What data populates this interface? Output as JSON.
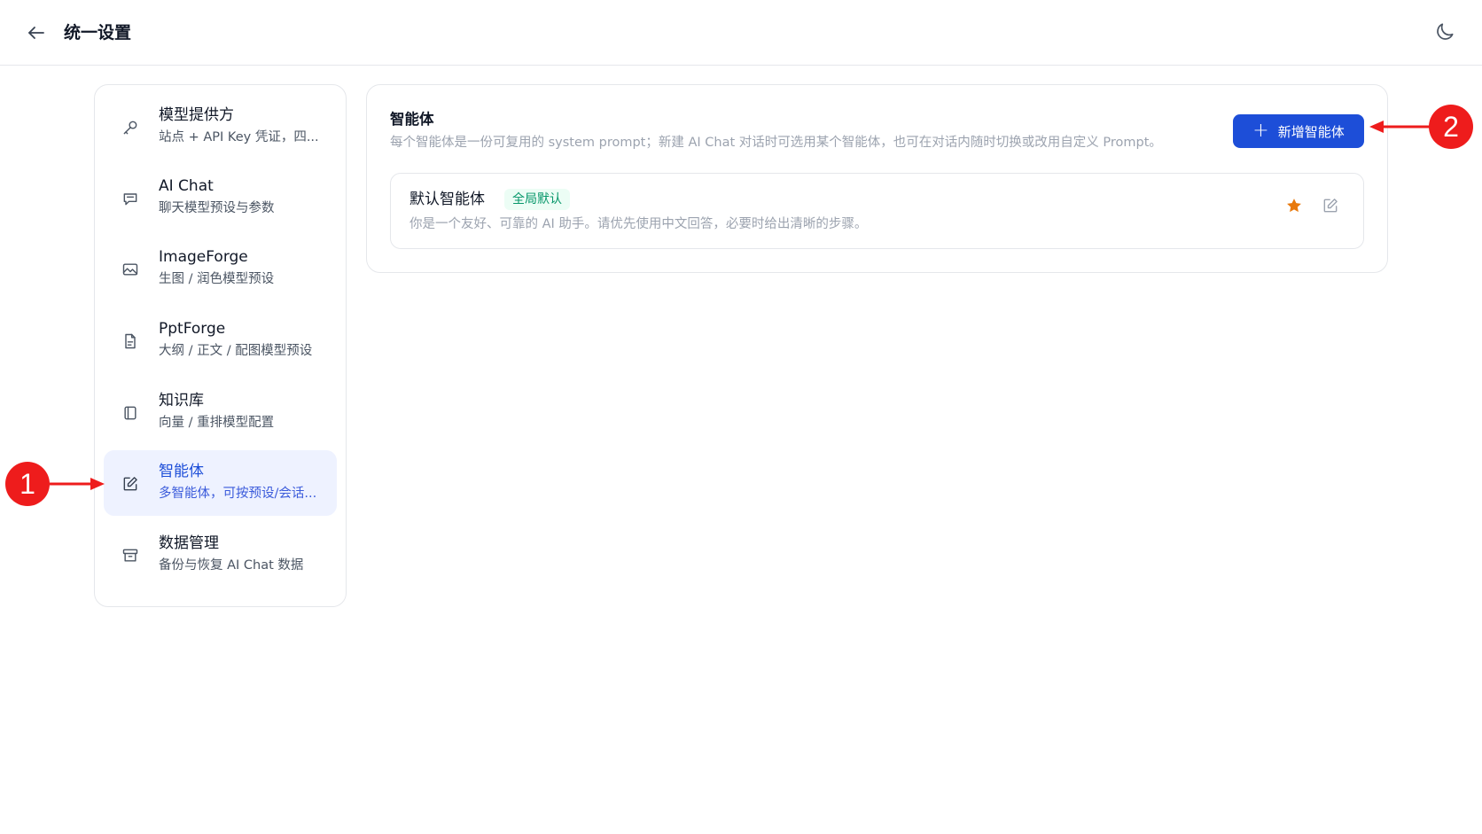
{
  "header": {
    "title": "统一设置",
    "back_icon": "arrow-left-icon",
    "theme_icon": "moon-icon"
  },
  "sidebar": {
    "items": [
      {
        "label": "模型提供方",
        "sub": "站点 + API Key 凭证，四...",
        "icon": "key-icon",
        "active": false
      },
      {
        "label": "AI Chat",
        "sub": "聊天模型预设与参数",
        "icon": "chat-icon",
        "active": false
      },
      {
        "label": "ImageForge",
        "sub": "生图 / 润色模型预设",
        "icon": "image-icon",
        "active": false
      },
      {
        "label": "PptForge",
        "sub": "大纲 / 正文 / 配图模型预设",
        "icon": "file-icon",
        "active": false
      },
      {
        "label": "知识库",
        "sub": "向量 / 重排模型配置",
        "icon": "book-icon",
        "active": false
      },
      {
        "label": "智能体",
        "sub": "多智能体，可按预设/会话...",
        "icon": "edit-icon",
        "active": true
      },
      {
        "label": "数据管理",
        "sub": "备份与恢复 AI Chat 数据",
        "icon": "archive-icon",
        "active": false
      }
    ]
  },
  "main": {
    "title": "智能体",
    "description": "每个智能体是一份可复用的 system prompt；新建 AI Chat 对话时可选用某个智能体，也可在对话内随时切换或改用自定义 Prompt。",
    "add_button_label": "新增智能体",
    "agents": [
      {
        "name": "默认智能体",
        "badge": "全局默认",
        "prompt": "你是一个友好、可靠的 AI 助手。请优先使用中文回答，必要时给出清晰的步骤。",
        "starred": true
      }
    ]
  },
  "annotations": [
    {
      "number": "1",
      "target": "sidebar-item-agents"
    },
    {
      "number": "2",
      "target": "add-agent-button"
    }
  ],
  "colors": {
    "accent": "#1d4ed8",
    "active_bg": "#eef2ff",
    "badge_bg": "#ecfdf5",
    "badge_text": "#059669",
    "star": "#e8790c",
    "marker": "#ee1c1c"
  }
}
